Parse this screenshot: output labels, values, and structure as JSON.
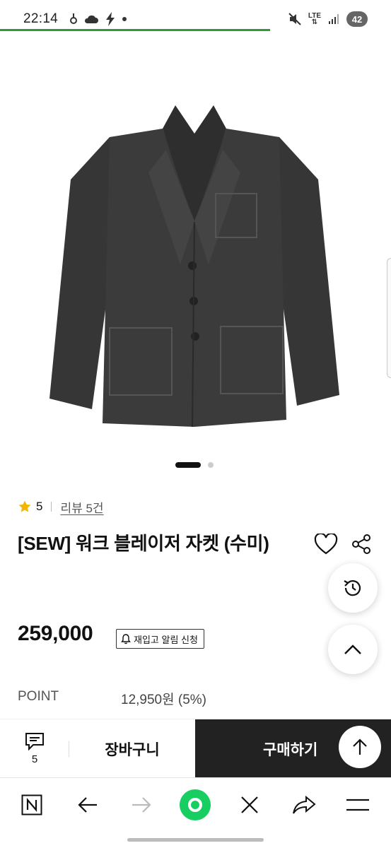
{
  "status_bar": {
    "time": "22:14",
    "network": "LTE",
    "battery": "42",
    "icons": [
      "sync-icon",
      "cloud-icon",
      "charging-icon",
      "dot-icon",
      "mute-icon",
      "signal-icon"
    ]
  },
  "page_load_progress": 0.69,
  "product": {
    "image_alt": "jacket-product-photo",
    "carousel": {
      "total": 2,
      "active": 1
    },
    "rating": "5",
    "review_link": "리뷰 5건",
    "title": "[SEW] 워크 블레이저 자켓 (수미)",
    "price": "259,000",
    "restock_label": "재입고 알림 신청",
    "point_label": "POINT",
    "point_value": "12,950원 (5%)"
  },
  "purchase_bar": {
    "comment_count": "5",
    "cart_label": "장바구니",
    "buy_label": "구매하기"
  },
  "colors": {
    "accent_green": "#2a9d3a",
    "star": "#f4b400",
    "buy_button": "#222222",
    "browser_green": "#19ce60"
  }
}
